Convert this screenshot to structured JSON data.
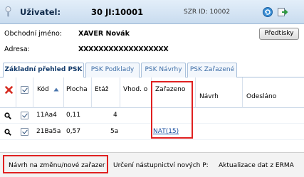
{
  "header": {
    "user_label": "Uživatel:",
    "ji": "30 JI:10001",
    "szr_label": "SZR ID:",
    "szr_value": "10002",
    "icons": [
      "user-icon",
      "refresh-icon",
      "exit-icon"
    ]
  },
  "info": {
    "business_name_label": "Obchodní jméno:",
    "business_name_value": "XAVER Novák",
    "address_label": "Adresa:",
    "address_value": "XXXXXXXXXXXXXXXXXX",
    "print_button": "Předtisky"
  },
  "tabs": [
    {
      "label": "Základní přehled PSK",
      "active": true
    },
    {
      "label": "PSK Podklady",
      "active": false
    },
    {
      "label": "PSK Návrhy",
      "active": false
    },
    {
      "label": "PSK Zařazené",
      "active": false
    }
  ],
  "grid": {
    "headers": {
      "kod": "Kód",
      "plocha": "Plocha",
      "etaz": "Etáž",
      "vhod": "Vhod. o",
      "zarazeno": "Zařazeno",
      "navrh": "Návrh",
      "odeslano": "Odesláno"
    },
    "rows": [
      {
        "kod": "11Aa4",
        "plocha": "0,11",
        "etaz": "4",
        "zarazeno": ""
      },
      {
        "kod": "21Ba5a",
        "plocha": "0,57",
        "etaz": "5a",
        "zarazeno": "NAT(15)"
      }
    ]
  },
  "footer": {
    "btn_navrh": "Návrh na změnu/nové zařazer",
    "btn_urceni": "Určení nástupnictví nových P:",
    "btn_aktualizace": "Aktualizace dat z ERMA"
  },
  "colors": {
    "header_bg": "#c9dcef",
    "highlight": "#e02020",
    "link": "#1a4fa0"
  }
}
